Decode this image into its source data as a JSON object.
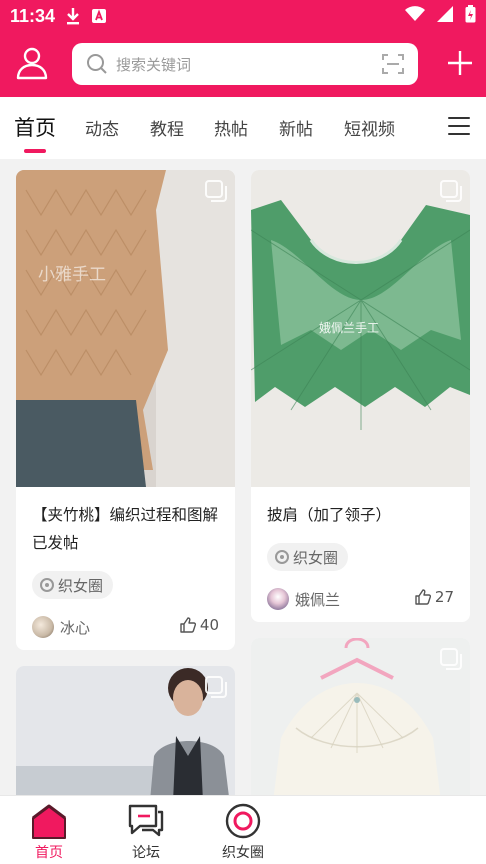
{
  "status_bar": {
    "time": "11:34"
  },
  "header": {
    "search_placeholder": "搜索关键词"
  },
  "tabs": [
    {
      "label": "首页",
      "active": true
    },
    {
      "label": "动态"
    },
    {
      "label": "教程"
    },
    {
      "label": "热帖"
    },
    {
      "label": "新帖"
    },
    {
      "label": "短视频"
    }
  ],
  "posts": [
    {
      "title": "【夹竹桃】编织过程和图解已发帖",
      "tag": "织女圈",
      "author": "冰心",
      "likes": "40",
      "watermark": "小雅手工"
    },
    {
      "title": "披肩（加了领子）",
      "tag": "织女圈",
      "author": "娥佩兰",
      "likes": "27",
      "watermark": "娥佩兰手工"
    },
    {
      "title": "",
      "tag": "",
      "author": "",
      "likes": ""
    },
    {
      "title": "",
      "tag": "",
      "author": "",
      "likes": ""
    }
  ],
  "bottom_nav": [
    {
      "label": "首页",
      "icon": "home-icon",
      "active": true
    },
    {
      "label": "论坛",
      "icon": "forum-icon"
    },
    {
      "label": "织女圈",
      "icon": "circle-icon"
    }
  ],
  "colors": {
    "brand": "#f0195f"
  }
}
